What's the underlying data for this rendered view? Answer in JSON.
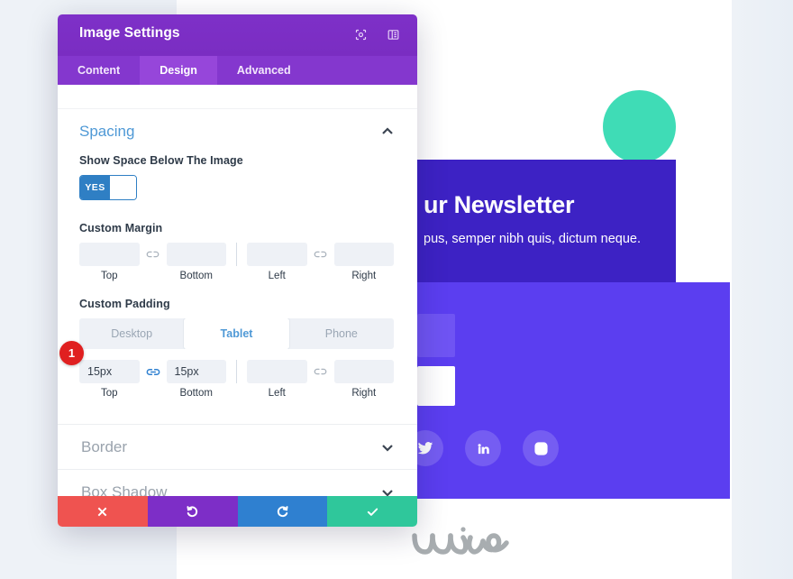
{
  "modal": {
    "title": "Image Settings",
    "header_icons": [
      {
        "name": "focus-target-icon"
      },
      {
        "name": "panel-layout-icon"
      }
    ],
    "tabs": [
      {
        "label": "Content",
        "active": false
      },
      {
        "label": "Design",
        "active": true
      },
      {
        "label": "Advanced",
        "active": false
      }
    ],
    "sections": {
      "spacing": {
        "title": "Spacing",
        "expanded": true,
        "show_space_below": {
          "label": "Show Space Below The Image",
          "toggle_value": "YES"
        },
        "custom_margin": {
          "label": "Custom Margin",
          "link_state": "unlinked",
          "fields": [
            {
              "label": "Top",
              "value": ""
            },
            {
              "label": "Bottom",
              "value": ""
            },
            {
              "label": "Left",
              "value": ""
            },
            {
              "label": "Right",
              "value": ""
            }
          ]
        },
        "custom_padding": {
          "label": "Custom Padding",
          "devices": [
            {
              "label": "Desktop",
              "active": false
            },
            {
              "label": "Tablet",
              "active": true
            },
            {
              "label": "Phone",
              "active": false
            }
          ],
          "link_state": "linked",
          "badge": "1",
          "fields": [
            {
              "label": "Top",
              "value": "15px"
            },
            {
              "label": "Bottom",
              "value": "15px"
            },
            {
              "label": "Left",
              "value": ""
            },
            {
              "label": "Right",
              "value": ""
            }
          ]
        }
      },
      "border": {
        "title": "Border",
        "expanded": false
      },
      "box_shadow": {
        "title": "Box Shadow",
        "expanded": false
      }
    },
    "footer_buttons": [
      {
        "name": "cancel-button",
        "icon": "close-icon",
        "color": "#ef5350"
      },
      {
        "name": "undo-button",
        "icon": "undo-icon",
        "color": "#7d2ec7"
      },
      {
        "name": "redo-button",
        "icon": "redo-icon",
        "color": "#2f80d0"
      },
      {
        "name": "save-button",
        "icon": "check-icon",
        "color": "#2fc79b"
      }
    ]
  },
  "page": {
    "newsletter": {
      "heading": "ur Newsletter",
      "subtext": "pus, semper nibh quis, dictum neque."
    },
    "social_icons": [
      {
        "name": "twitter-icon"
      },
      {
        "name": "linkedin-icon"
      },
      {
        "name": "instagram-icon"
      }
    ],
    "logo_text": "uire",
    "colors": {
      "teal_circle": "#3fdcb6",
      "newsletter_band": "#3d22c4",
      "form_band": "#5b3ef0"
    }
  }
}
